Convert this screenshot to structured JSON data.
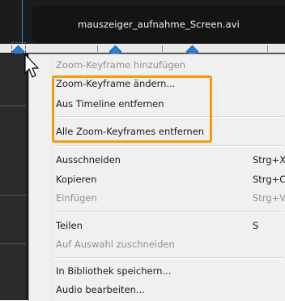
{
  "timeline": {
    "clip_title": "mauszeiger_aufnahme_Screen.avi"
  },
  "menu": {
    "items": [
      {
        "label": "Zoom-Keyframe hinzufügen",
        "shortcut": "",
        "enabled": false
      },
      {
        "label": "Zoom-Keyframe ändern...",
        "shortcut": "",
        "enabled": true
      },
      {
        "label": "Aus Timeline entfernen",
        "shortcut": "",
        "enabled": true
      },
      {
        "label": "Alle Zoom-Keyframes entfernen",
        "shortcut": "",
        "enabled": true
      },
      {
        "label": "Ausschneiden",
        "shortcut": "Strg+X",
        "enabled": true
      },
      {
        "label": "Kopieren",
        "shortcut": "Strg+C",
        "enabled": true
      },
      {
        "label": "Einfügen",
        "shortcut": "Strg+V",
        "enabled": false
      },
      {
        "label": "Teilen",
        "shortcut": "S",
        "enabled": true
      },
      {
        "label": "Auf Auswahl zuschneiden",
        "shortcut": "",
        "enabled": false
      },
      {
        "label": "In Bibliothek speichern...",
        "shortcut": "",
        "enabled": true
      },
      {
        "label": "Audio bearbeiten...",
        "shortcut": "",
        "enabled": true
      }
    ]
  },
  "colors": {
    "highlight": "#f39c12",
    "keyframe": "#2c7fd6",
    "playhead": "#3b8bd6"
  },
  "icons": {
    "cursor": "mouse-pointer-icon",
    "keyframe": "keyframe-diamond-icon"
  }
}
